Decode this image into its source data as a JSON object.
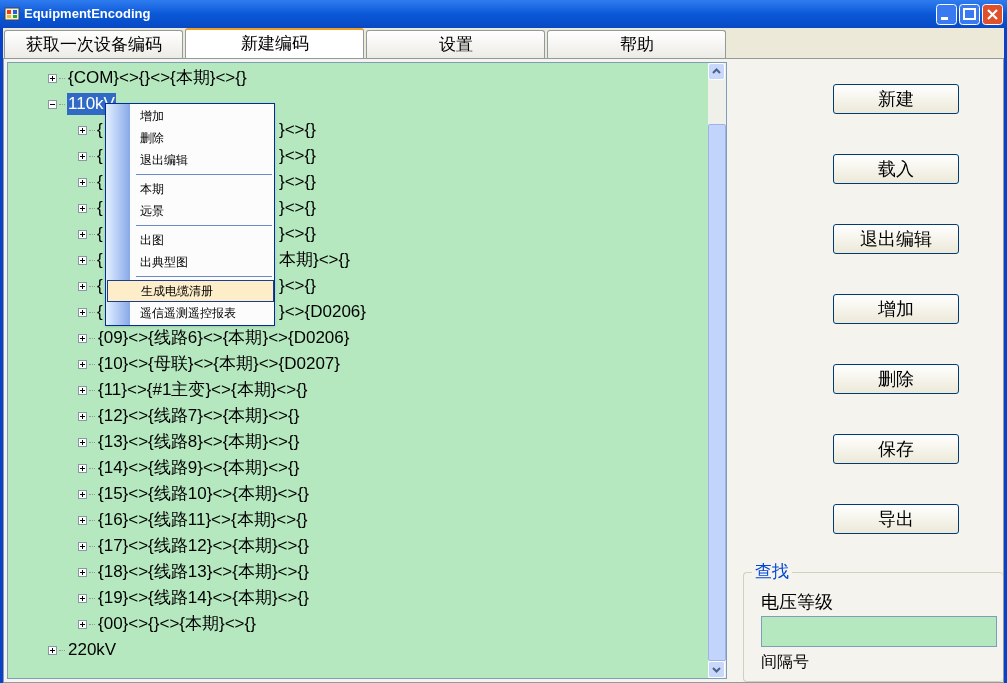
{
  "window": {
    "title": "EquipmentEncoding"
  },
  "tabs": [
    {
      "label": "获取一次设备编码",
      "selected": false
    },
    {
      "label": "新建编码",
      "selected": true
    },
    {
      "label": "设置",
      "selected": false
    },
    {
      "label": "帮助",
      "selected": false
    }
  ],
  "tree": {
    "items": [
      {
        "label": "{COM}<>{}<>{本期}<>{}",
        "expanded": false,
        "selected": false
      },
      {
        "label": "110kV",
        "expanded": true,
        "selected": true,
        "children": [
          {
            "head": "{",
            "tail": "}<>{}",
            "expanded": false
          },
          {
            "head": "{",
            "tail": "}<>{}",
            "expanded": false
          },
          {
            "head": "{",
            "tail": "}<>{}",
            "expanded": false
          },
          {
            "head": "{",
            "tail": "}<>{}",
            "expanded": false
          },
          {
            "head": "{",
            "tail": "}<>{}",
            "expanded": false
          },
          {
            "head": "{",
            "tail": "本期}<>{}",
            "expanded": false
          },
          {
            "head": "{",
            "tail": "}<>{}",
            "expanded": false
          },
          {
            "head": "{",
            "tail": "}<>{D0206}",
            "expanded": false
          },
          {
            "label": "{09}<>{线路6}<>{本期}<>{D0206}",
            "expanded": false
          },
          {
            "label": "{10}<>{母联}<>{本期}<>{D0207}",
            "expanded": false
          },
          {
            "label": "{11}<>{#1主变}<>{本期}<>{}",
            "expanded": false
          },
          {
            "label": "{12}<>{线路7}<>{本期}<>{}",
            "expanded": false
          },
          {
            "label": "{13}<>{线路8}<>{本期}<>{}",
            "expanded": false
          },
          {
            "label": "{14}<>{线路9}<>{本期}<>{}",
            "expanded": false
          },
          {
            "label": "{15}<>{线路10}<>{本期}<>{}",
            "expanded": false
          },
          {
            "label": "{16}<>{线路11}<>{本期}<>{}",
            "expanded": false
          },
          {
            "label": "{17}<>{线路12}<>{本期}<>{}",
            "expanded": false
          },
          {
            "label": "{18}<>{线路13}<>{本期}<>{}",
            "expanded": false
          },
          {
            "label": "{19}<>{线路14}<>{本期}<>{}",
            "expanded": false
          },
          {
            "label": "{00}<>{}<>{本期}<>{}",
            "expanded": false
          }
        ]
      },
      {
        "label": "220kV",
        "expanded": false,
        "selected": false
      }
    ]
  },
  "context_menu": {
    "groups": [
      [
        {
          "label": "增加",
          "highlighted": false
        },
        {
          "label": "删除",
          "highlighted": false
        },
        {
          "label": "退出编辑",
          "highlighted": false
        }
      ],
      [
        {
          "label": "本期",
          "highlighted": false
        },
        {
          "label": "远景",
          "highlighted": false
        }
      ],
      [
        {
          "label": "出图",
          "highlighted": false
        },
        {
          "label": "出典型图",
          "highlighted": false
        }
      ],
      [
        {
          "label": "生成电缆清册",
          "highlighted": true
        },
        {
          "label": "遥信遥测遥控报表",
          "highlighted": false
        }
      ]
    ]
  },
  "buttons": [
    "新建",
    "载入",
    "退出编辑",
    "增加",
    "删除",
    "保存",
    "导出"
  ],
  "search": {
    "title": "查找",
    "voltage_label": "电压等级",
    "interval_label": "间隔号"
  }
}
